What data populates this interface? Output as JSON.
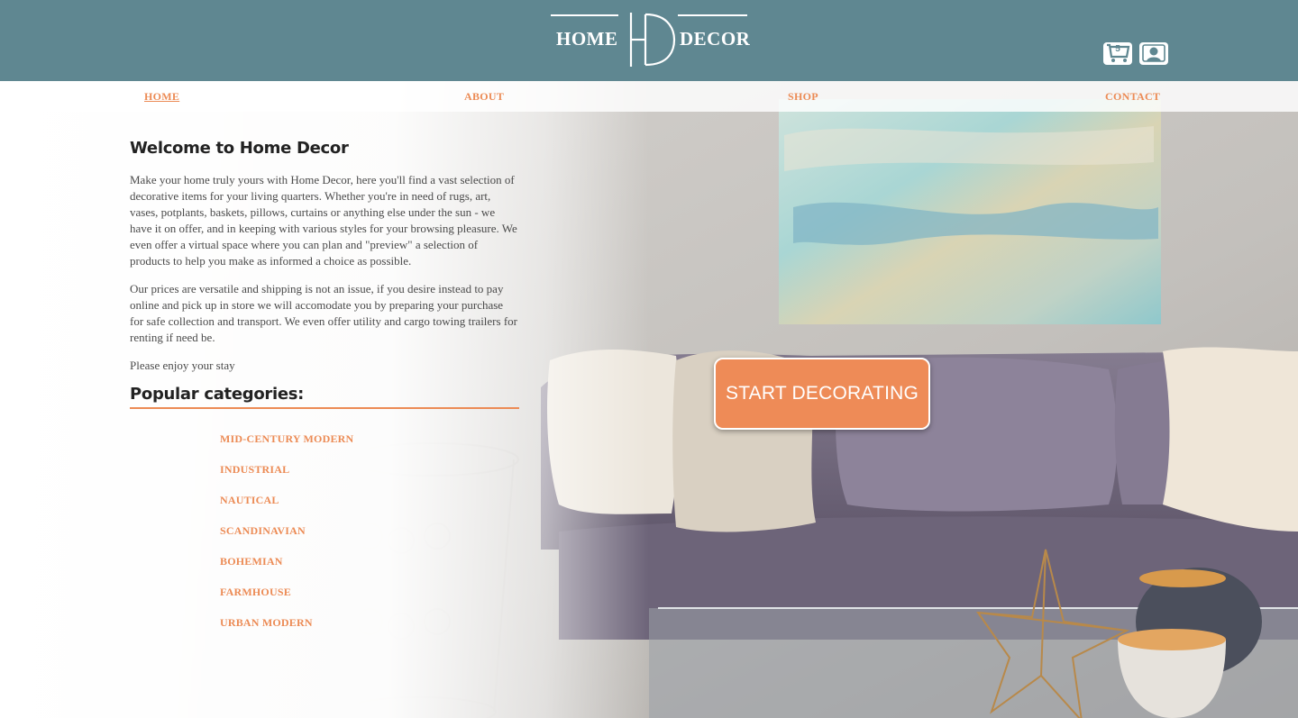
{
  "brand": {
    "left_word": "HOME",
    "right_word": "DECOR"
  },
  "header": {
    "cart": {
      "count": "5",
      "icon": "cart-icon"
    },
    "account": {
      "icon": "user-icon"
    }
  },
  "nav": {
    "items": [
      {
        "label": "HOME",
        "active": true
      },
      {
        "label": "ABOUT",
        "active": false
      },
      {
        "label": "SHOP",
        "active": false
      },
      {
        "label": "CONTACT",
        "active": false
      }
    ]
  },
  "intro": {
    "title": "Welcome to Home Decor",
    "paragraphs": [
      "Make your home truly yours with Home Decor, here you'll find a vast selection of decorative items for your living quarters. Whether you're in need of rugs, art, vases, potplants, baskets, pillows, curtains or anything else under the sun - we have it on offer, and in keeping with various styles for your browsing pleasure. We even offer a virtual space where you can plan and \"preview\" a selection of products to help you make as informed a choice as possible.",
      "Our prices are versatile and shipping is not an issue, if you desire instead to pay online and pick up in store we will accomodate you by preparing your purchase for safe collection and transport. We even offer utility and cargo towing trailers for renting if need be.",
      "Please enjoy your stay"
    ]
  },
  "categories": {
    "title": "Popular categories:",
    "items": [
      "MID-CENTURY MODERN",
      "INDUSTRIAL",
      "NAUTICAL",
      "SCANDINAVIAN",
      "BOHEMIAN",
      "FARMHOUSE",
      "URBAN MODERN"
    ]
  },
  "cta": {
    "label": "START DECORATING"
  },
  "colors": {
    "header": "#5f8791",
    "accent": "#ec8b55",
    "button": "#ee8b57",
    "text": "#4a4a4a"
  }
}
